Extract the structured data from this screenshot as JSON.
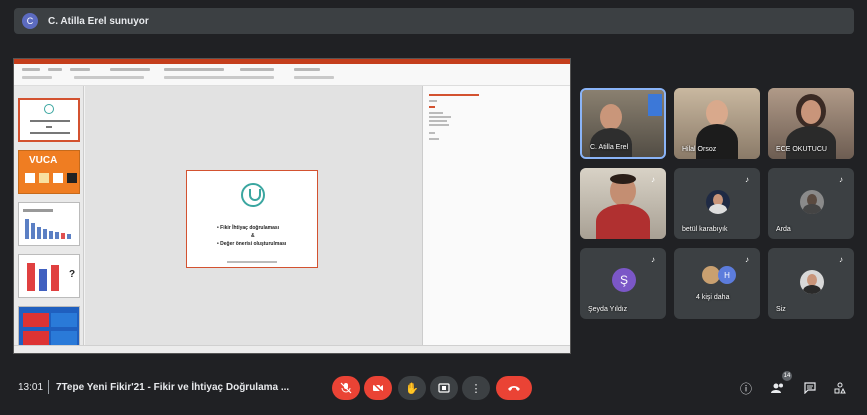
{
  "presenter": {
    "avatar_letter": "C",
    "text": "C. Atilla Erel sunuyor"
  },
  "slide": {
    "line1": "• Fikir İhtiyaç doğrulaması",
    "line2": "&",
    "line3": "• Değer önerisi oluşturulması"
  },
  "thumbnails": {
    "vuca_text": "VUCA"
  },
  "participants": [
    {
      "name": "C. Atilla Erel",
      "type": "video",
      "active": true
    },
    {
      "name": "Hilal Orsoz",
      "type": "video"
    },
    {
      "name": "ECE OKUTUCU",
      "type": "video"
    },
    {
      "name": "",
      "type": "video"
    },
    {
      "name": "betül karabıyık",
      "type": "avatar"
    },
    {
      "name": "Arda",
      "type": "avatar"
    },
    {
      "name": "Şeyda Yıldız",
      "type": "avatar",
      "initial": "Ş",
      "color": "#7b57c7"
    },
    {
      "name": "4 kişi daha",
      "type": "group",
      "initial": "H"
    },
    {
      "name": "Siz",
      "type": "avatar"
    }
  ],
  "meeting": {
    "time": "13:01",
    "title": "7Tepe Yeni Fikir'21 - Fikir ve İhtiyaç Doğrulama ..."
  },
  "controls": {
    "participant_count": "14"
  },
  "colors": {
    "background": "#202124",
    "tile": "#3c4043",
    "red": "#ea4335",
    "accent": "#8ab4f8"
  }
}
